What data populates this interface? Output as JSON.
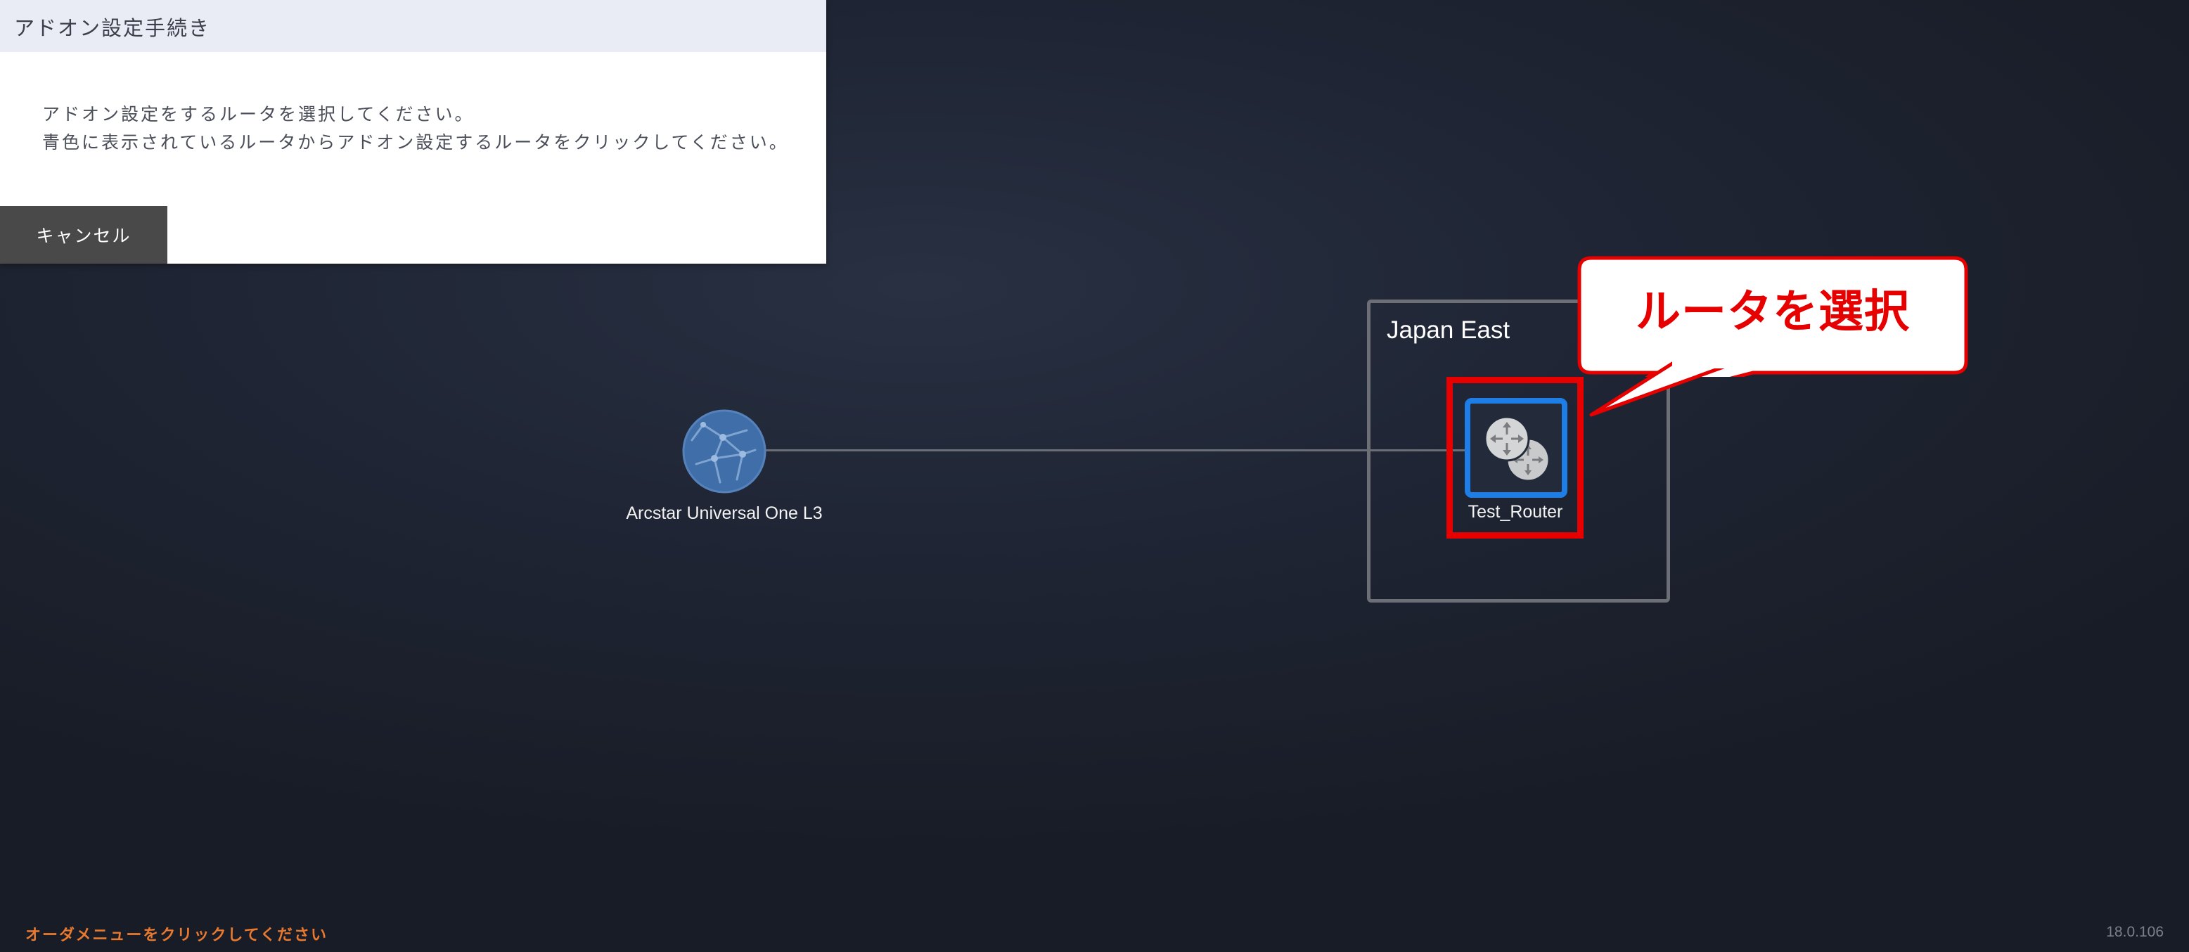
{
  "dialog": {
    "title": "アドオン設定手続き",
    "message_line1": "アドオン設定をするルータを選択してください。",
    "message_line2": "青色に表示されているルータからアドオン設定するルータをクリックしてください。",
    "cancel_label": "キャンセル"
  },
  "topology": {
    "cloud": {
      "label": "Arcstar Universal One L3",
      "icon": "globe-network-icon",
      "color": "#3f6ea8"
    },
    "region": {
      "label": "Japan East",
      "border_color": "#6c6f76"
    },
    "router": {
      "label": "Test_Router",
      "icon": "router-icon",
      "selectable_color": "#1f7ee6"
    }
  },
  "annotation": {
    "callout_text": "ルータを選択",
    "highlight_color": "#e60000"
  },
  "footer": {
    "hint": "オーダメニューをクリックしてください",
    "hint_color": "#e8792f",
    "version": "18.0.106"
  }
}
